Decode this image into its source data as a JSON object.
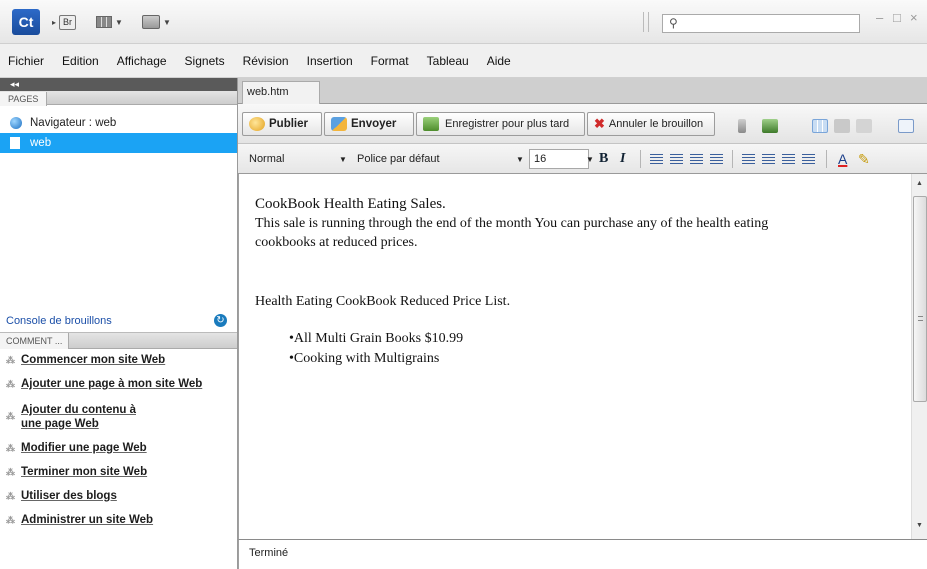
{
  "app": {
    "logo_text": "Ct",
    "bridge_badge": "Br",
    "search_placeholder": "",
    "window_controls": {
      "minimize": "–",
      "maximize": "□",
      "close": "×"
    }
  },
  "menu": [
    "Fichier",
    "Edition",
    "Affichage",
    "Signets",
    "Révision",
    "Insertion",
    "Format",
    "Tableau",
    "Aide"
  ],
  "left_panel": {
    "collapse_glyph": "◂◂",
    "pages_tab": "PAGES",
    "pages": [
      {
        "label": "Navigateur : web",
        "icon": "globe-icon",
        "selected": false
      },
      {
        "label": "web",
        "icon": "page-icon",
        "selected": true
      }
    ],
    "drafts_console": "Console de brouillons",
    "comment_tab": "COMMENT ...",
    "help_topics": [
      "Commencer mon site Web",
      "Ajouter une page à mon site Web",
      "Ajouter du contenu à une page Web",
      "Modifier une page Web",
      "Terminer mon site Web",
      "Utiliser des blogs",
      "Administrer un site Web"
    ]
  },
  "document": {
    "tab_label": "web.htm",
    "toolbar": {
      "publish": "Publier",
      "send": "Envoyer",
      "save_later": "Enregistrer pour plus tard",
      "cancel_draft": "Annuler le brouillon"
    },
    "format_bar": {
      "style": "Normal",
      "font": "Police par défaut",
      "size": "16",
      "bold": "B",
      "italic": "I"
    },
    "content": {
      "heading": "CookBook Health Eating Sales.",
      "paragraph_line1": "This sale is running through the end of the month You can purchase any of the health eating",
      "paragraph_line2": "cookbooks at reduced prices.",
      "list_title": "Health Eating CookBook Reduced Price List.",
      "list_items": [
        "•All Multi Grain Books    $10.99",
        "•Cooking with Multigrains"
      ]
    },
    "status": "Terminé"
  },
  "colors": {
    "selection": "#1ba3f4",
    "link": "#1b4fa8",
    "logo": "#1a4c9c"
  }
}
